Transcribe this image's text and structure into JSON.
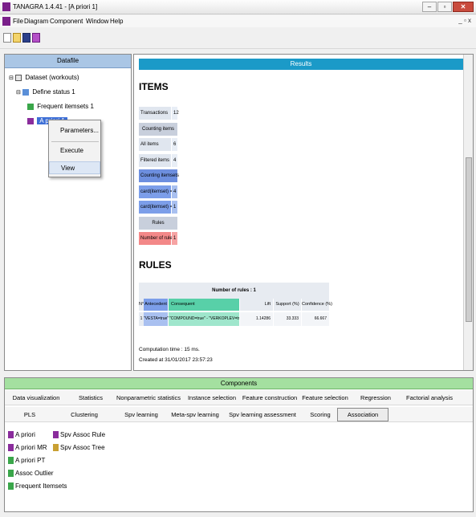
{
  "window": {
    "title": "TANAGRA 1.4.41 - [A priori 1]",
    "controls": {
      "minimize": "–",
      "restore": "▫",
      "close": "✕"
    },
    "mdi_controls": "_ ▫ x"
  },
  "menu": [
    "File",
    "Diagram",
    "Component",
    "Window",
    "Help"
  ],
  "left_panel": {
    "title": "Datafile",
    "tree": {
      "root": "Dataset (workouts)",
      "define_status": "Define status 1",
      "frequent_itemsets": "Frequent itemsets 1",
      "apriori": "A priori 1"
    }
  },
  "context_menu": {
    "items": [
      "Parameters...",
      "Execute",
      "View"
    ]
  },
  "results": {
    "header": "Results",
    "items_title": "ITEMS",
    "items_table": [
      {
        "kind": "row",
        "label": "Transactions",
        "value": "12"
      },
      {
        "kind": "header",
        "label": "Counting items"
      },
      {
        "kind": "row",
        "label": "All items",
        "value": "6"
      },
      {
        "kind": "row",
        "label": "Filtered items",
        "value": "4"
      },
      {
        "kind": "header-blue",
        "label": "Counting itemsets"
      },
      {
        "kind": "row-blue",
        "label": "card(itemset) = 2",
        "value": "4"
      },
      {
        "kind": "row-blue",
        "label": "card(itemset) = 3",
        "value": "1"
      },
      {
        "kind": "header",
        "label": "Rules"
      },
      {
        "kind": "row-red",
        "label": "Number of rules",
        "value": "1"
      }
    ],
    "rules_title": "RULES",
    "rules_table": {
      "title": "Number of rules : 1",
      "headers": [
        "N°",
        "Antecedent",
        "Consequent",
        "Lift",
        "Support (%)",
        "Confidence (%)"
      ],
      "rows": [
        [
          "1",
          "\"VESTA=true\"",
          "\"COMPOUND=true\" - \"VERKOPLEV=true\"",
          "1.14286",
          "33.333",
          "66.667"
        ]
      ]
    },
    "computation_time": "Computation time : 15 ms.",
    "created_at": "Created at 31/01/2017 23:57:23"
  },
  "components": {
    "header": "Components",
    "row1": [
      "Data visualization",
      "Statistics",
      "Nonparametric statistics",
      "Instance selection",
      "Feature construction",
      "Feature selection",
      "Regression",
      "Factorial analysis"
    ],
    "row2": [
      "PLS",
      "Clustering",
      "Spv learning",
      "Meta-spv learning",
      "Spv learning assessment",
      "Scoring",
      "Association"
    ],
    "active_tab": "Association",
    "items_col1": [
      "A priori",
      "A priori MR",
      "A priori PT",
      "Assoc Outlier",
      "Frequent Itemsets"
    ],
    "items_col2": [
      "Spv Assoc Rule",
      "Spv Assoc Tree"
    ]
  },
  "colors": {
    "results_accent": "#1b9ac8",
    "left_header": "#aac6e5",
    "components_header": "#a4e0a0",
    "tree_selection": "#3d6fd6"
  },
  "icons": {
    "app": "tanagra-app-icon",
    "toolbar": [
      "new-file-icon",
      "open-folder-icon",
      "save-icon",
      "component-icon"
    ]
  }
}
